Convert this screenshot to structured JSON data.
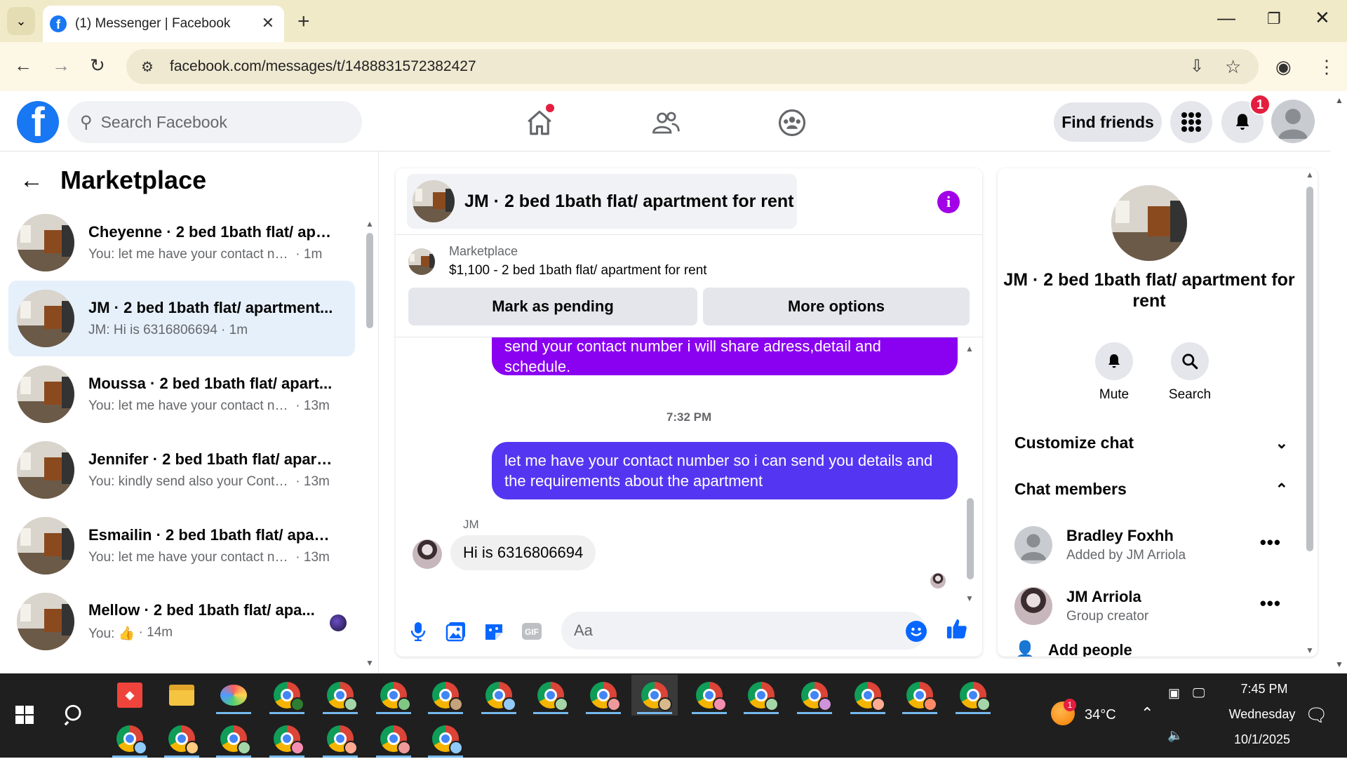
{
  "browser": {
    "tab_title": "(1) Messenger | Facebook",
    "favicon_letter": "f",
    "url": "facebook.com/messages/t/1488831572382427"
  },
  "facebook": {
    "logo_letter": "f",
    "search_placeholder": "Search Facebook",
    "find_friends": "Find friends",
    "notification_count": "1",
    "brand_color": "#1877f2"
  },
  "left": {
    "title": "Marketplace",
    "conversations": [
      {
        "name": "Cheyenne · 2 bed 1bath flat/ apa...",
        "snippet": "You: let me have your contact num...",
        "time": "1m"
      },
      {
        "name": "JM · 2 bed 1bath flat/ apartment...",
        "snippet": "JM: Hi is 6316806694",
        "time": "1m"
      },
      {
        "name": "Moussa · 2 bed 1bath flat/ apart...",
        "snippet": "You: let me have your contact nu...",
        "time": "13m"
      },
      {
        "name": "Jennifer · 2 bed 1bath flat/ apart...",
        "snippet": "You: kindly send also your Contac...",
        "time": "13m"
      },
      {
        "name": "Esmailin · 2 bed 1bath flat/ apart...",
        "snippet": "You: let me have your contact nu...",
        "time": "13m"
      },
      {
        "name": "Mellow · 2 bed 1bath flat/ apa...",
        "snippet": "You: 👍",
        "time": "14m"
      }
    ]
  },
  "chat": {
    "title": "JM · 2 bed 1bath flat/ apartment for rent",
    "listing_source": "Marketplace",
    "listing_title": "$1,100 - 2 bed 1bath flat/ apartment for rent",
    "mark_pending": "Mark as pending",
    "more_options": "More options",
    "messages": {
      "out1": "send your contact number i will share adress,detail and schedule.",
      "timestamp": "7:32 PM",
      "out2": "let me have your contact number so i can send you details and the requirements about the apartment",
      "sender": "JM",
      "in1": "Hi is 6316806694"
    },
    "composer_placeholder": "Aa",
    "accent_color": "#8a2be2"
  },
  "right": {
    "name": "JM · 2 bed 1bath flat/ apartment for rent",
    "mute": "Mute",
    "search": "Search",
    "customize_chat": "Customize chat",
    "chat_members": "Chat members",
    "members": [
      {
        "name": "Bradley Foxhh",
        "sub": "Added by JM Arriola"
      },
      {
        "name": "JM Arriola",
        "sub": "Group creator"
      }
    ],
    "add_people": "Add people"
  },
  "taskbar": {
    "temperature": "34°C",
    "time": "7:45 PM",
    "day": "Wednesday",
    "date": "10/1/2025",
    "weather_badge": "1"
  }
}
